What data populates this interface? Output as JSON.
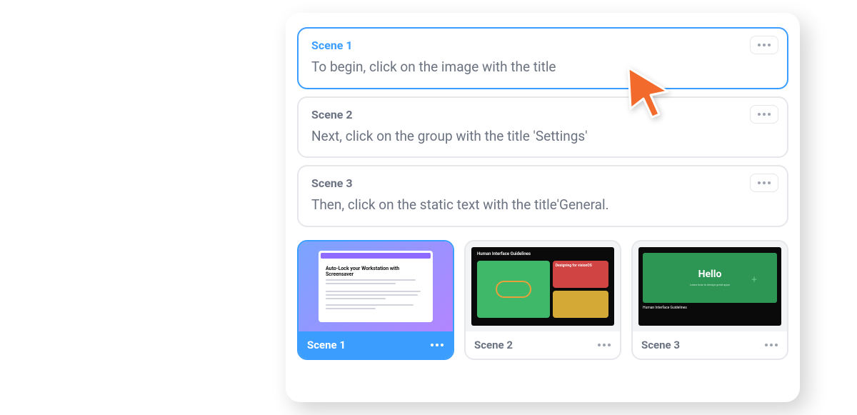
{
  "scenes": [
    {
      "title": "Scene 1",
      "description": "To begin, click on the image with the title",
      "selected": true
    },
    {
      "title": "Scene 2",
      "description": "Next, click on the group with the title 'Settings'",
      "selected": false
    },
    {
      "title": "Scene 3",
      "description": "Then, click on the static text with the title'General.",
      "selected": false
    }
  ],
  "thumbnails": [
    {
      "label": "Scene 1",
      "selected": true,
      "preview": {
        "type": "document",
        "doc_title": "Auto-Lock your Workstation with Screensaver"
      }
    },
    {
      "label": "Scene 2",
      "selected": false,
      "preview": {
        "type": "hig-blocks",
        "heading": "Human Interface Guidelines",
        "block_text": "Designing for visionOS"
      }
    },
    {
      "label": "Scene 3",
      "selected": false,
      "preview": {
        "type": "hello",
        "word": "Hello",
        "footer": "Human Interface Guidelines"
      }
    }
  ],
  "colors": {
    "accent": "#3b9eff",
    "cursor": "#f26b2c"
  }
}
